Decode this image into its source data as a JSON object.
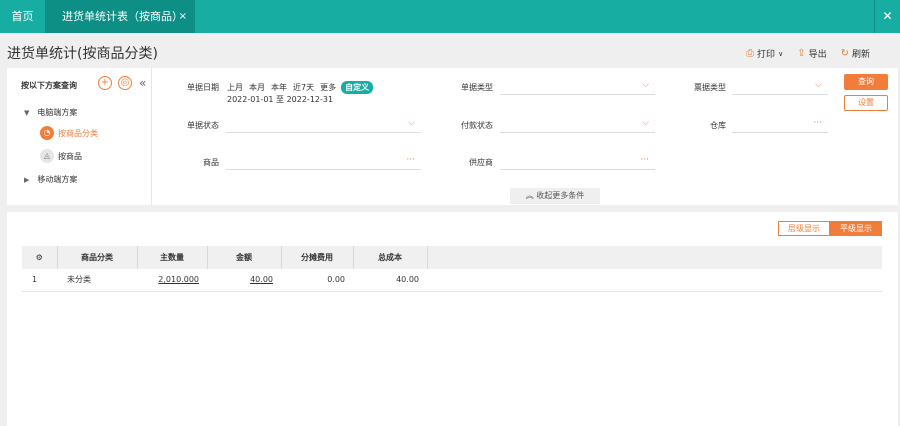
{
  "tabs": {
    "home": "首页",
    "active": "进货单统计表（按商品）",
    "tab_close": "×",
    "window_close": "✕"
  },
  "page_title": "进货单统计(按商品分类)",
  "toolbar": {
    "print": "打印",
    "print_arrow": "∨",
    "export": "导出",
    "refresh": "刷新"
  },
  "tree": {
    "head": "按以下方案查询",
    "add": "+",
    "target": "◎",
    "collapse": "«",
    "groups": [
      {
        "label": "电脑端方案",
        "arrow": "▼"
      },
      {
        "label": "移动端方案",
        "arrow": "▶"
      }
    ],
    "leaves": [
      {
        "label": "按商品分类",
        "icon": "◔"
      },
      {
        "label": "按商品",
        "icon": "◬"
      }
    ]
  },
  "filters": {
    "date_label": "单据日期",
    "date_options": [
      "上月",
      "本月",
      "本年",
      "近7天",
      "更多"
    ],
    "date_custom": "自定义",
    "date_range": "2022-01-01 至 2022-12-31",
    "doc_type": "单据类型",
    "bill_type": "票据类型",
    "doc_status": "单据状态",
    "pay_status": "付款状态",
    "warehouse": "仓库",
    "product": "商品",
    "supplier": "供应商",
    "dropdown_icon": "⌵",
    "more_icon": "···",
    "query_btn": "查询",
    "settings_btn": "设置",
    "collapse_more": "收起更多条件"
  },
  "view": {
    "level": "层级显示",
    "flat": "平级显示"
  },
  "table": {
    "settings_icon": "⚙",
    "headers": [
      "商品分类",
      "主数量",
      "金额",
      "分摊费用",
      "总成本"
    ],
    "rows": [
      {
        "index": "1",
        "category": "未分类",
        "qty": "2,010.000",
        "amount": "40.00",
        "fee": "0.00",
        "cost": "40.00"
      }
    ]
  }
}
